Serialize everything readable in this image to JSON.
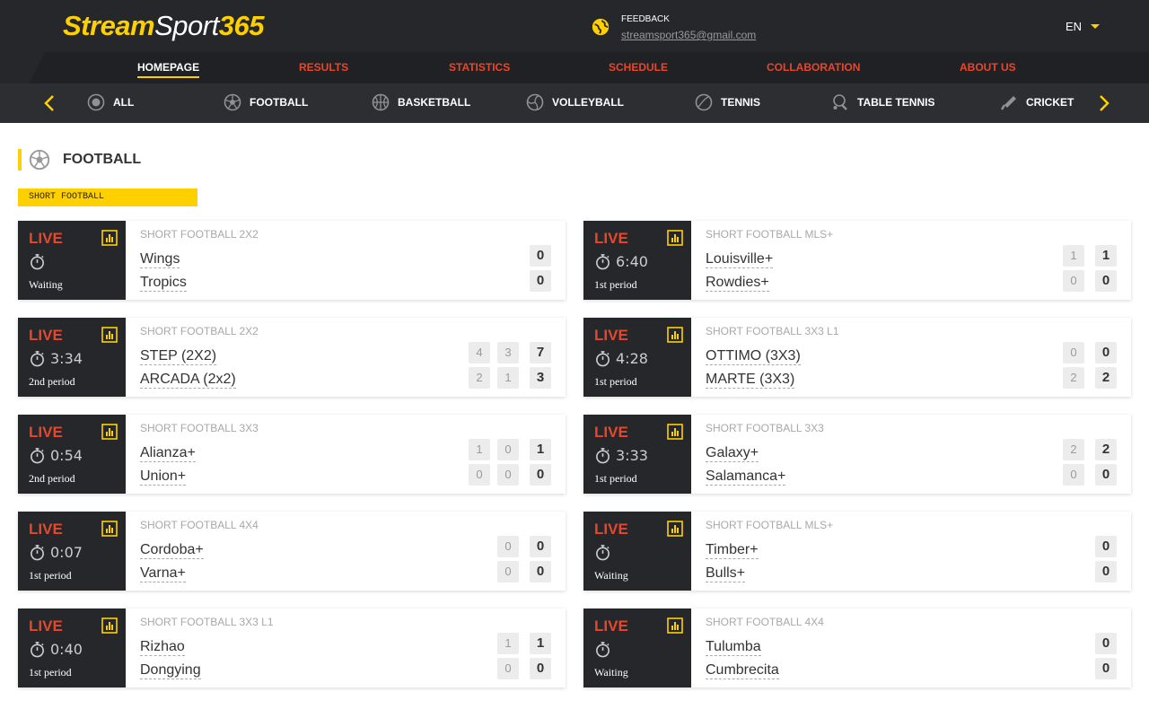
{
  "header": {
    "logo_parts": [
      "Stream",
      "Sport",
      "365"
    ],
    "feedback_label": "FEEDBACK",
    "feedback_email": "streamsport365@gmail.com",
    "language": "EN",
    "globe_icon": "globe-icon"
  },
  "nav": [
    {
      "label": "HOMEPAGE",
      "active": true
    },
    {
      "label": "RESULTS",
      "active": false
    },
    {
      "label": "STATISTICS",
      "active": false
    },
    {
      "label": "SCHEDULE",
      "active": false
    },
    {
      "label": "COLLABORATION",
      "active": false
    },
    {
      "label": "ABOUT US",
      "active": false
    }
  ],
  "sports": [
    {
      "label": "ALL",
      "icon": "all-icon"
    },
    {
      "label": "FOOTBALL",
      "icon": "football-icon"
    },
    {
      "label": "BASKETBALL",
      "icon": "basketball-icon"
    },
    {
      "label": "VOLLEYBALL",
      "icon": "volleyball-icon"
    },
    {
      "label": "TENNIS",
      "icon": "tennis-icon"
    },
    {
      "label": "TABLE TENNIS",
      "icon": "table-tennis-icon"
    },
    {
      "label": "CRICKET",
      "icon": "cricket-icon"
    }
  ],
  "section": {
    "title": "FOOTBALL",
    "icon": "football-icon",
    "subtitle": "SHORT FOOTBALL"
  },
  "matches": [
    {
      "status": "LIVE",
      "time": "",
      "period": "Waiting",
      "tournament": "SHORT FOOTBALL 2X2",
      "team1": "Wings",
      "team2": "Tropics",
      "periods1": [],
      "periods2": [],
      "total1": "0",
      "total2": "0"
    },
    {
      "status": "LIVE",
      "time": "6:40",
      "period": "1st period",
      "tournament": "SHORT FOOTBALL MLS+",
      "team1": "Louisville+",
      "team2": "Rowdies+",
      "periods1": [
        "1"
      ],
      "periods2": [
        "0"
      ],
      "total1": "1",
      "total2": "0"
    },
    {
      "status": "LIVE",
      "time": "3:34",
      "period": "2nd period",
      "tournament": "SHORT FOOTBALL 2X2",
      "team1": "STEP (2X2)",
      "team2": "ARCADA (2x2)",
      "periods1": [
        "4",
        "3"
      ],
      "periods2": [
        "2",
        "1"
      ],
      "total1": "7",
      "total2": "3"
    },
    {
      "status": "LIVE",
      "time": "4:28",
      "period": "1st period",
      "tournament": "SHORT FOOTBALL 3X3 L1",
      "team1": "OTTIMO (3X3)",
      "team2": "MARTE (3X3)",
      "periods1": [
        "0"
      ],
      "periods2": [
        "2"
      ],
      "total1": "0",
      "total2": "2"
    },
    {
      "status": "LIVE",
      "time": "0:54",
      "period": "2nd period",
      "tournament": "SHORT FOOTBALL 3X3",
      "team1": "Alianza+",
      "team2": "Union+",
      "periods1": [
        "1",
        "0"
      ],
      "periods2": [
        "0",
        "0"
      ],
      "total1": "1",
      "total2": "0"
    },
    {
      "status": "LIVE",
      "time": "3:33",
      "period": "1st period",
      "tournament": "SHORT FOOTBALL 3X3",
      "team1": "Galaxy+",
      "team2": "Salamanca+",
      "periods1": [
        "2"
      ],
      "periods2": [
        "0"
      ],
      "total1": "2",
      "total2": "0"
    },
    {
      "status": "LIVE",
      "time": "0:07",
      "period": "1st period",
      "tournament": "SHORT FOOTBALL 4X4",
      "team1": "Cordoba+",
      "team2": "Varna+",
      "periods1": [
        "0"
      ],
      "periods2": [
        "0"
      ],
      "total1": "0",
      "total2": "0"
    },
    {
      "status": "LIVE",
      "time": "",
      "period": "Waiting",
      "tournament": "SHORT FOOTBALL MLS+",
      "team1": "Timber+",
      "team2": "Bulls+",
      "periods1": [],
      "periods2": [],
      "total1": "0",
      "total2": "0"
    },
    {
      "status": "LIVE",
      "time": "0:40",
      "period": "1st period",
      "tournament": "SHORT FOOTBALL 3X3 L1",
      "team1": "Rizhao",
      "team2": "Dongying",
      "periods1": [
        "1"
      ],
      "periods2": [
        "0"
      ],
      "total1": "1",
      "total2": "0"
    },
    {
      "status": "LIVE",
      "time": "",
      "period": "Waiting",
      "tournament": "SHORT FOOTBALL 4X4",
      "team1": "Tulumba",
      "team2": "Cumbrecita",
      "periods1": [],
      "periods2": [],
      "total1": "0",
      "total2": "0"
    }
  ],
  "colors": {
    "accent": "#ffd000",
    "live": "#e8472b",
    "dark": "#25272b"
  }
}
